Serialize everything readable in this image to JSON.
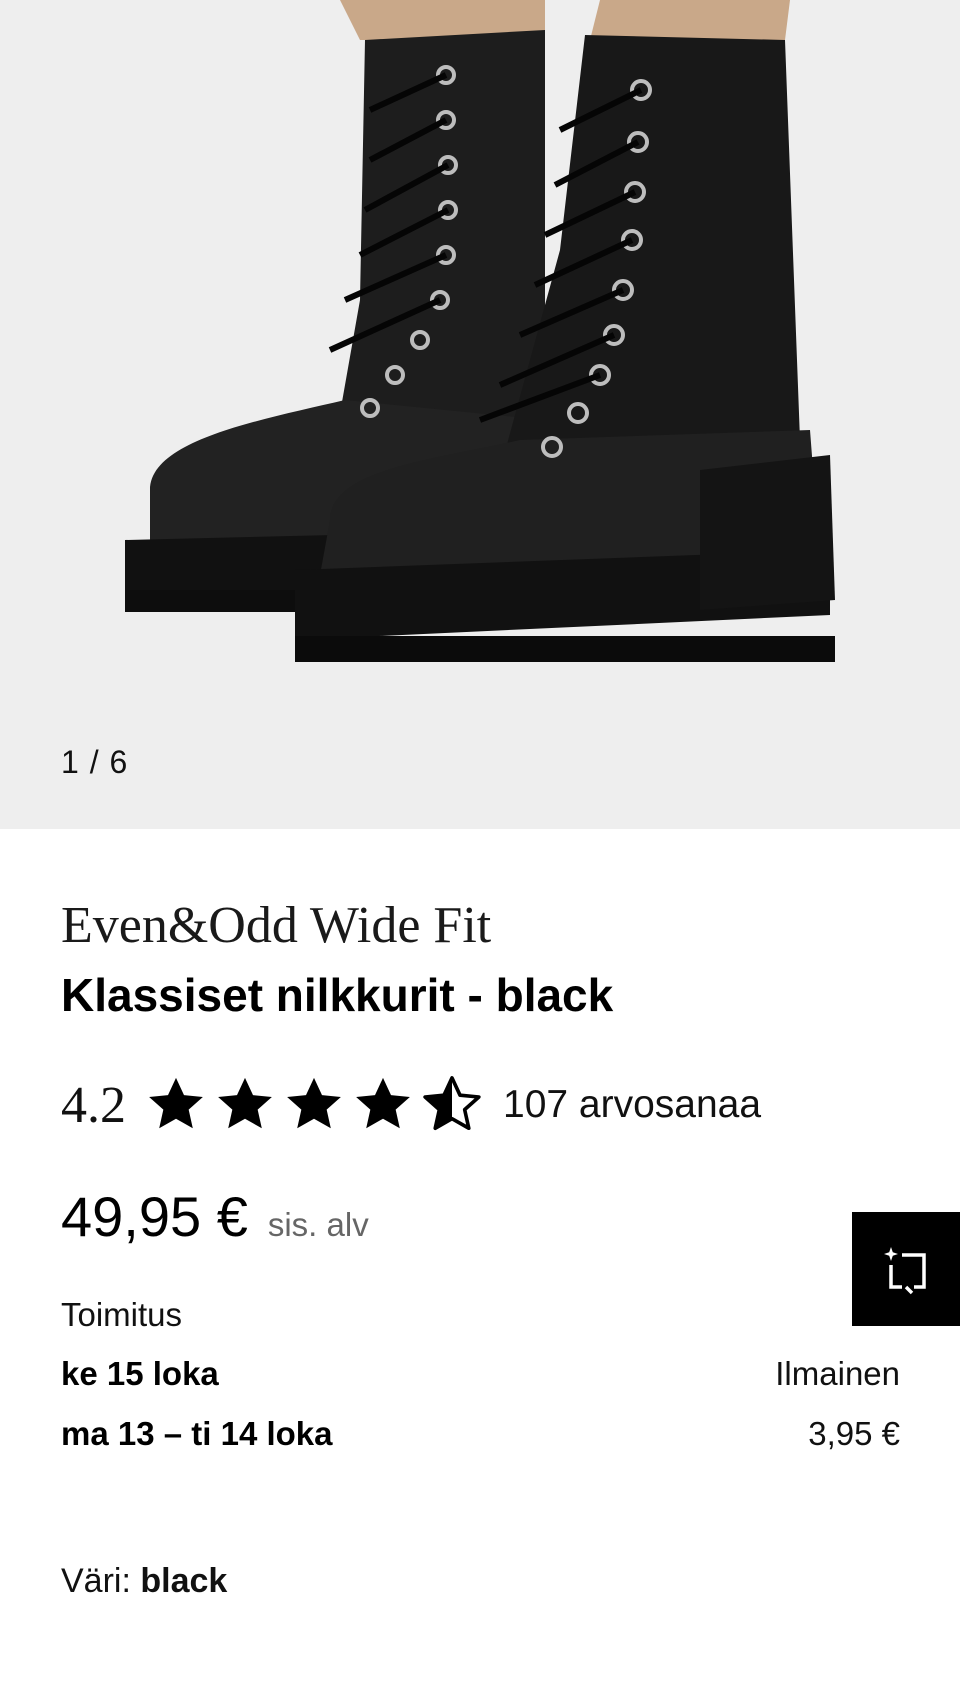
{
  "gallery": {
    "image_description_icon": "product-photo-black-lace-up-boots",
    "counter": "1 / 6",
    "current": 1,
    "total": 6
  },
  "product": {
    "brand": "Even&Odd Wide Fit",
    "name": "Klassiset nilkkurit - black"
  },
  "rating": {
    "value_label": "4.2",
    "value": 4.2,
    "max": 5,
    "count_label": "107 arvosanaa"
  },
  "price": {
    "amount": "49,95 €",
    "vat_note": "sis. alv"
  },
  "ai_button": {
    "icon": "sparkle-crop-icon"
  },
  "delivery": {
    "label": "Toimitus",
    "options": [
      {
        "date": "ke 15 loka",
        "cost": "Ilmainen"
      },
      {
        "date": "ma 13 – ti 14 loka",
        "cost": "3,95 €"
      }
    ]
  },
  "color": {
    "label": "Väri:",
    "value": "black"
  },
  "colors": {
    "gallery_bg": "#eeeeee",
    "boot": "#1b1b1b",
    "text": "#000000",
    "muted": "#666666"
  }
}
